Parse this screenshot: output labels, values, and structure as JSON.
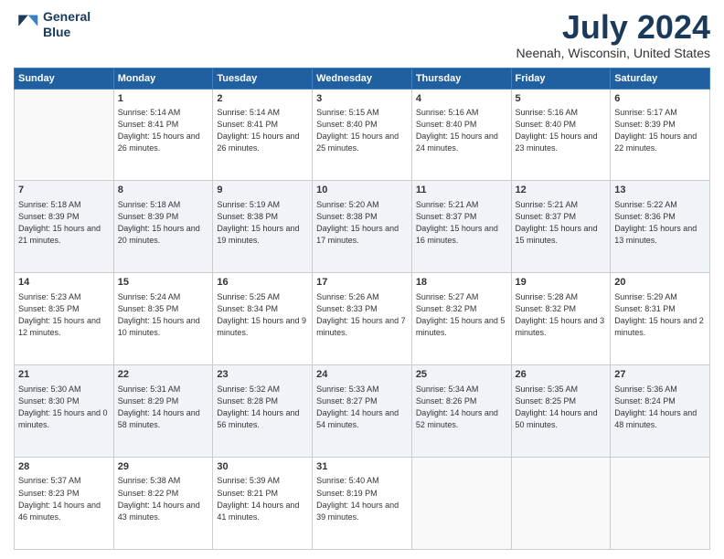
{
  "header": {
    "logo_line1": "General",
    "logo_line2": "Blue",
    "month_year": "July 2024",
    "location": "Neenah, Wisconsin, United States"
  },
  "days_of_week": [
    "Sunday",
    "Monday",
    "Tuesday",
    "Wednesday",
    "Thursday",
    "Friday",
    "Saturday"
  ],
  "weeks": [
    [
      {
        "day": "",
        "info": ""
      },
      {
        "day": "1",
        "info": "Sunrise: 5:14 AM\nSunset: 8:41 PM\nDaylight: 15 hours\nand 26 minutes."
      },
      {
        "day": "2",
        "info": "Sunrise: 5:14 AM\nSunset: 8:41 PM\nDaylight: 15 hours\nand 26 minutes."
      },
      {
        "day": "3",
        "info": "Sunrise: 5:15 AM\nSunset: 8:40 PM\nDaylight: 15 hours\nand 25 minutes."
      },
      {
        "day": "4",
        "info": "Sunrise: 5:16 AM\nSunset: 8:40 PM\nDaylight: 15 hours\nand 24 minutes."
      },
      {
        "day": "5",
        "info": "Sunrise: 5:16 AM\nSunset: 8:40 PM\nDaylight: 15 hours\nand 23 minutes."
      },
      {
        "day": "6",
        "info": "Sunrise: 5:17 AM\nSunset: 8:39 PM\nDaylight: 15 hours\nand 22 minutes."
      }
    ],
    [
      {
        "day": "7",
        "info": "Sunrise: 5:18 AM\nSunset: 8:39 PM\nDaylight: 15 hours\nand 21 minutes."
      },
      {
        "day": "8",
        "info": "Sunrise: 5:18 AM\nSunset: 8:39 PM\nDaylight: 15 hours\nand 20 minutes."
      },
      {
        "day": "9",
        "info": "Sunrise: 5:19 AM\nSunset: 8:38 PM\nDaylight: 15 hours\nand 19 minutes."
      },
      {
        "day": "10",
        "info": "Sunrise: 5:20 AM\nSunset: 8:38 PM\nDaylight: 15 hours\nand 17 minutes."
      },
      {
        "day": "11",
        "info": "Sunrise: 5:21 AM\nSunset: 8:37 PM\nDaylight: 15 hours\nand 16 minutes."
      },
      {
        "day": "12",
        "info": "Sunrise: 5:21 AM\nSunset: 8:37 PM\nDaylight: 15 hours\nand 15 minutes."
      },
      {
        "day": "13",
        "info": "Sunrise: 5:22 AM\nSunset: 8:36 PM\nDaylight: 15 hours\nand 13 minutes."
      }
    ],
    [
      {
        "day": "14",
        "info": "Sunrise: 5:23 AM\nSunset: 8:35 PM\nDaylight: 15 hours\nand 12 minutes."
      },
      {
        "day": "15",
        "info": "Sunrise: 5:24 AM\nSunset: 8:35 PM\nDaylight: 15 hours\nand 10 minutes."
      },
      {
        "day": "16",
        "info": "Sunrise: 5:25 AM\nSunset: 8:34 PM\nDaylight: 15 hours\nand 9 minutes."
      },
      {
        "day": "17",
        "info": "Sunrise: 5:26 AM\nSunset: 8:33 PM\nDaylight: 15 hours\nand 7 minutes."
      },
      {
        "day": "18",
        "info": "Sunrise: 5:27 AM\nSunset: 8:32 PM\nDaylight: 15 hours\nand 5 minutes."
      },
      {
        "day": "19",
        "info": "Sunrise: 5:28 AM\nSunset: 8:32 PM\nDaylight: 15 hours\nand 3 minutes."
      },
      {
        "day": "20",
        "info": "Sunrise: 5:29 AM\nSunset: 8:31 PM\nDaylight: 15 hours\nand 2 minutes."
      }
    ],
    [
      {
        "day": "21",
        "info": "Sunrise: 5:30 AM\nSunset: 8:30 PM\nDaylight: 15 hours\nand 0 minutes."
      },
      {
        "day": "22",
        "info": "Sunrise: 5:31 AM\nSunset: 8:29 PM\nDaylight: 14 hours\nand 58 minutes."
      },
      {
        "day": "23",
        "info": "Sunrise: 5:32 AM\nSunset: 8:28 PM\nDaylight: 14 hours\nand 56 minutes."
      },
      {
        "day": "24",
        "info": "Sunrise: 5:33 AM\nSunset: 8:27 PM\nDaylight: 14 hours\nand 54 minutes."
      },
      {
        "day": "25",
        "info": "Sunrise: 5:34 AM\nSunset: 8:26 PM\nDaylight: 14 hours\nand 52 minutes."
      },
      {
        "day": "26",
        "info": "Sunrise: 5:35 AM\nSunset: 8:25 PM\nDaylight: 14 hours\nand 50 minutes."
      },
      {
        "day": "27",
        "info": "Sunrise: 5:36 AM\nSunset: 8:24 PM\nDaylight: 14 hours\nand 48 minutes."
      }
    ],
    [
      {
        "day": "28",
        "info": "Sunrise: 5:37 AM\nSunset: 8:23 PM\nDaylight: 14 hours\nand 46 minutes."
      },
      {
        "day": "29",
        "info": "Sunrise: 5:38 AM\nSunset: 8:22 PM\nDaylight: 14 hours\nand 43 minutes."
      },
      {
        "day": "30",
        "info": "Sunrise: 5:39 AM\nSunset: 8:21 PM\nDaylight: 14 hours\nand 41 minutes."
      },
      {
        "day": "31",
        "info": "Sunrise: 5:40 AM\nSunset: 8:19 PM\nDaylight: 14 hours\nand 39 minutes."
      },
      {
        "day": "",
        "info": ""
      },
      {
        "day": "",
        "info": ""
      },
      {
        "day": "",
        "info": ""
      }
    ]
  ]
}
